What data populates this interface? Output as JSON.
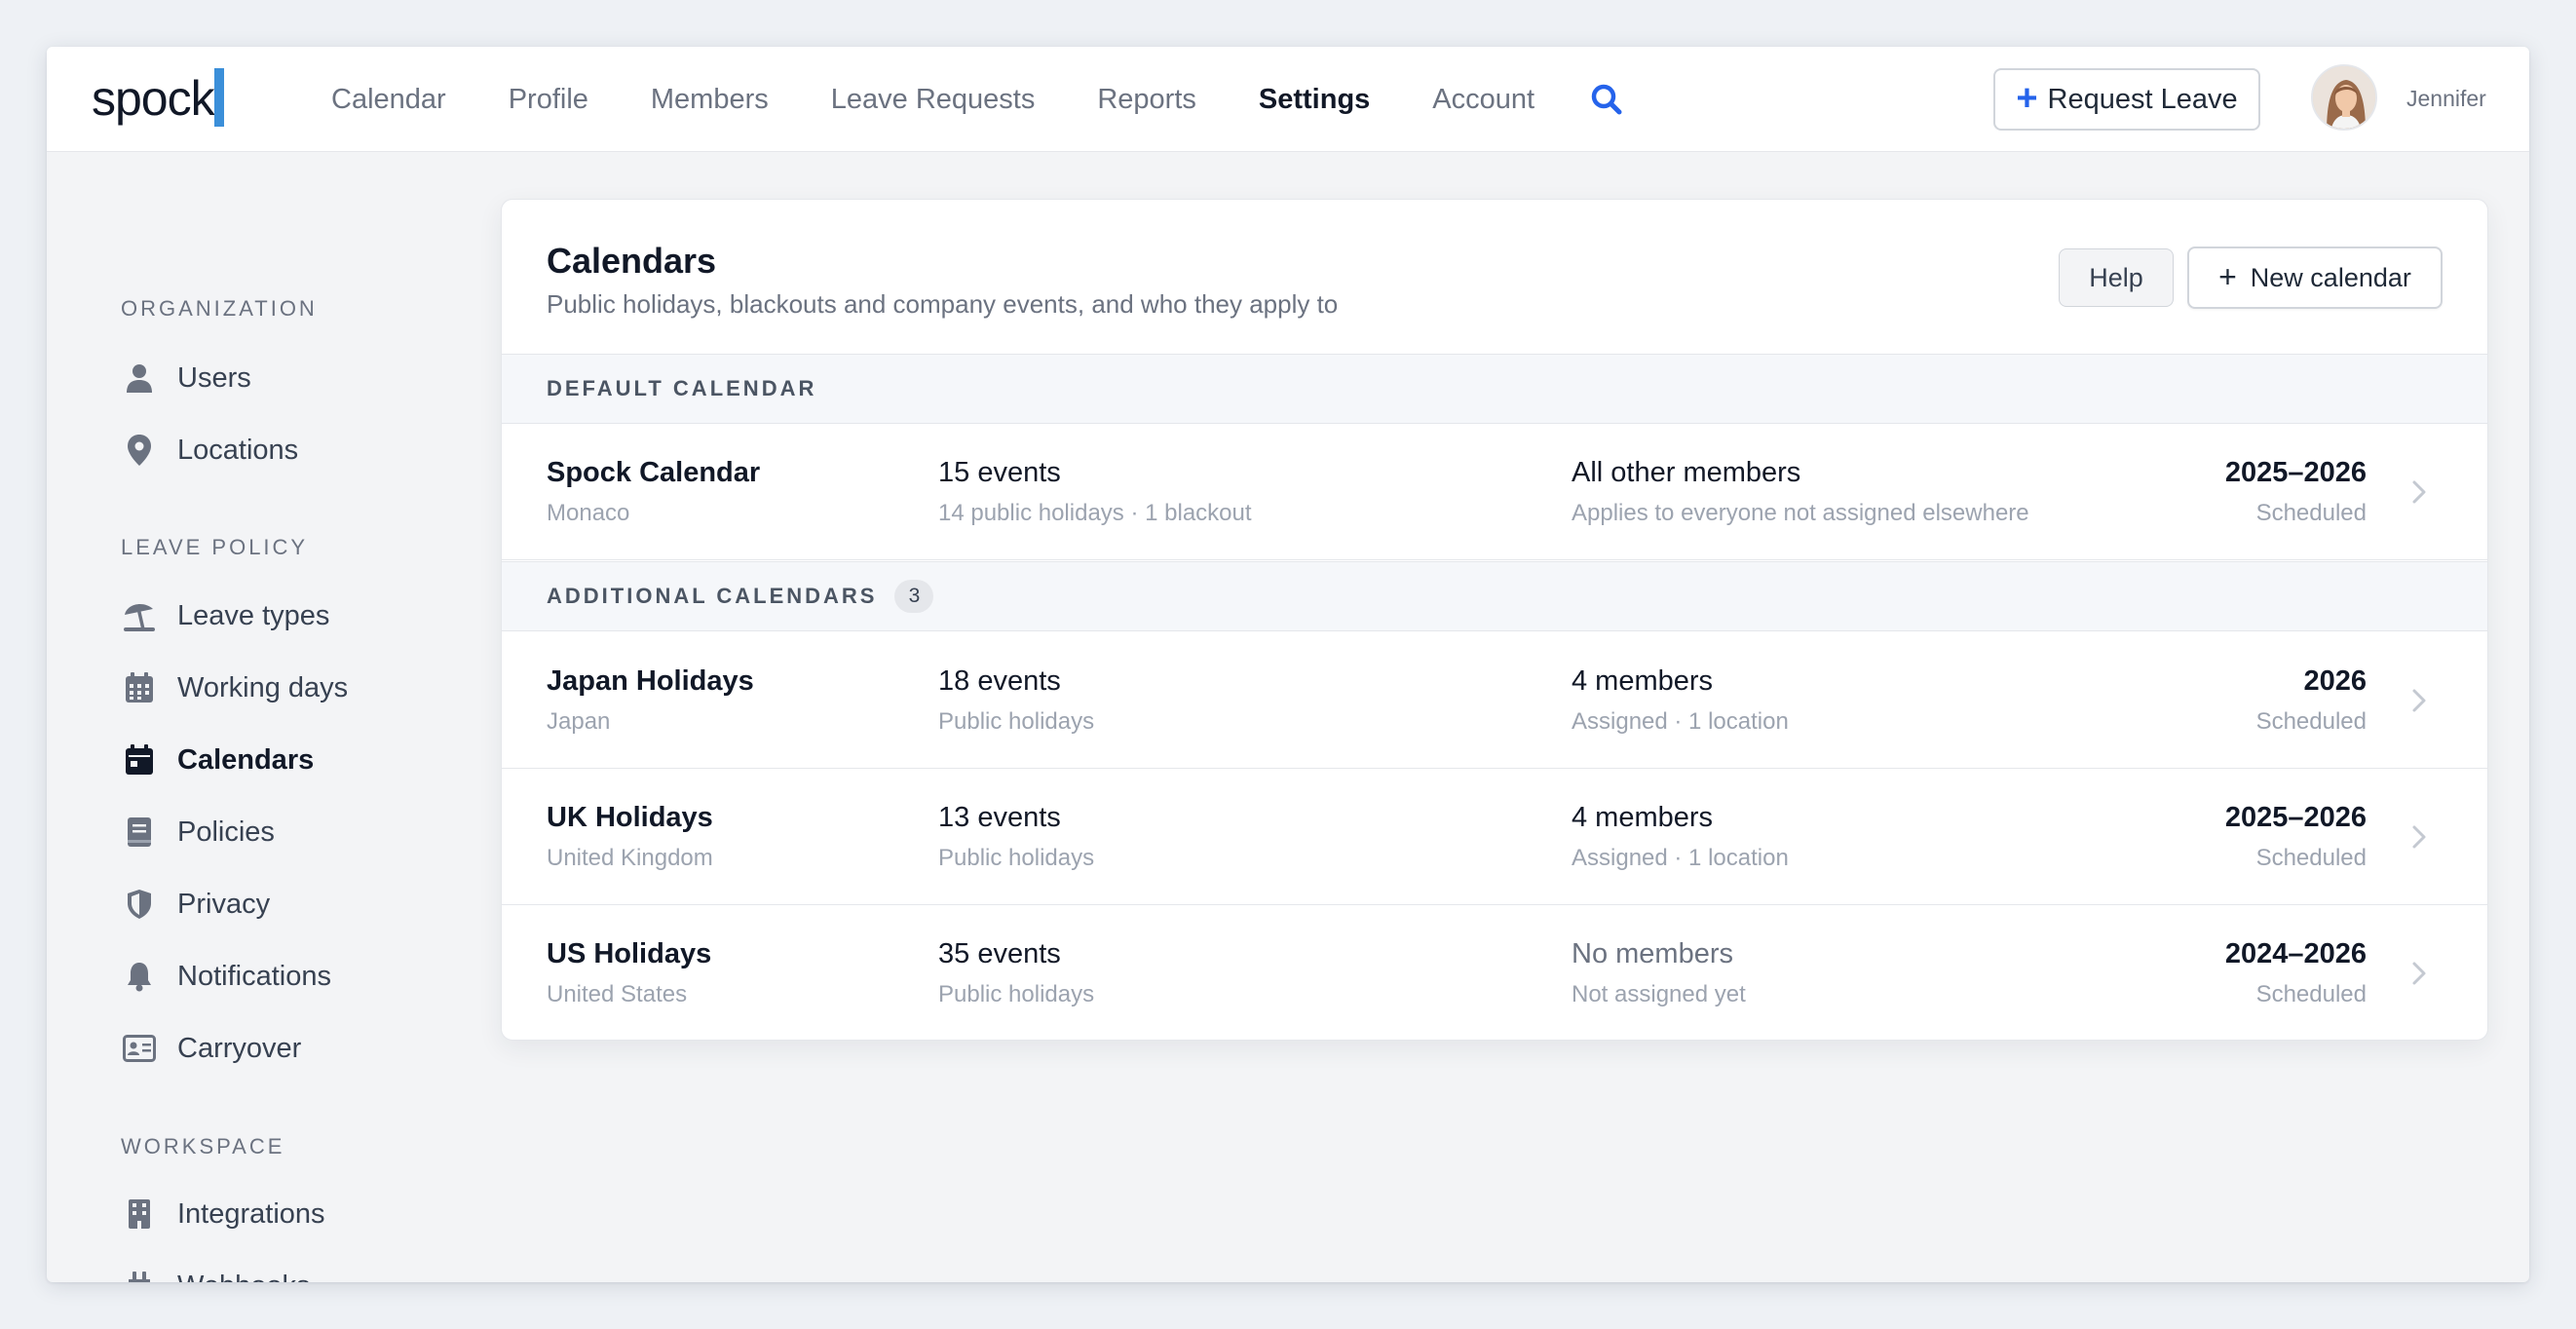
{
  "brand": {
    "name": "spock",
    "accent": "#3b8fd9"
  },
  "nav": {
    "items": [
      {
        "label": "Calendar",
        "active": false
      },
      {
        "label": "Profile",
        "active": false
      },
      {
        "label": "Members",
        "active": false
      },
      {
        "label": "Leave Requests",
        "active": false
      },
      {
        "label": "Reports",
        "active": false
      },
      {
        "label": "Settings",
        "active": true
      },
      {
        "label": "Account",
        "active": false
      }
    ],
    "search_icon": "search-icon",
    "request_button": "Request Leave",
    "user_name": "Jennifer"
  },
  "sidebar": {
    "sections": [
      {
        "title": "ORGANIZATION",
        "items": [
          {
            "label": "Users",
            "icon": "user-icon",
            "active": false
          },
          {
            "label": "Locations",
            "icon": "location-pin-icon",
            "active": false
          }
        ]
      },
      {
        "title": "LEAVE POLICY",
        "items": [
          {
            "label": "Leave types",
            "icon": "beach-umbrella-icon",
            "active": false
          },
          {
            "label": "Working days",
            "icon": "calendar-grid-icon",
            "active": false
          },
          {
            "label": "Calendars",
            "icon": "calendar-icon",
            "active": true
          },
          {
            "label": "Policies",
            "icon": "book-icon",
            "active": false
          },
          {
            "label": "Privacy",
            "icon": "shield-icon",
            "active": false
          },
          {
            "label": "Notifications",
            "icon": "bell-icon",
            "active": false
          },
          {
            "label": "Carryover",
            "icon": "id-card-icon",
            "active": false
          }
        ]
      },
      {
        "title": "WORKSPACE",
        "items": [
          {
            "label": "Integrations",
            "icon": "building-icon",
            "active": false
          },
          {
            "label": "Webhooks",
            "icon": "plug-icon",
            "active": false
          }
        ]
      }
    ]
  },
  "calendars": {
    "title": "Calendars",
    "subtitle": "Public holidays, blackouts and company events, and who they apply to",
    "help_button": "Help",
    "new_button": "New calendar",
    "default_section": {
      "label": "DEFAULT CALENDAR"
    },
    "default_rows": [
      {
        "name": "Spock Calendar",
        "country": "Monaco",
        "events": "15 events",
        "events_detail": "14 public holidays · 1 blackout",
        "members": "All other members",
        "members_detail": "Applies to everyone not assigned elsewhere",
        "years": "2025–2026",
        "status": "Scheduled"
      }
    ],
    "additional_section": {
      "label": "ADDITIONAL CALENDARS",
      "count": "3"
    },
    "additional_rows": [
      {
        "name": "Japan Holidays",
        "country": "Japan",
        "events": "18 events",
        "events_detail": "Public holidays",
        "members": "4 members",
        "members_detail": "Assigned · 1 location",
        "years": "2026",
        "status": "Scheduled"
      },
      {
        "name": "UK Holidays",
        "country": "United Kingdom",
        "events": "13 events",
        "events_detail": "Public holidays",
        "members": "4 members",
        "members_detail": "Assigned · 1 location",
        "years": "2025–2026",
        "status": "Scheduled"
      },
      {
        "name": "US Holidays",
        "country": "United States",
        "events": "35 events",
        "events_detail": "Public holidays",
        "members": "No members",
        "members_detail": "Not assigned yet",
        "years": "2024–2026",
        "status": "Scheduled"
      }
    ]
  }
}
